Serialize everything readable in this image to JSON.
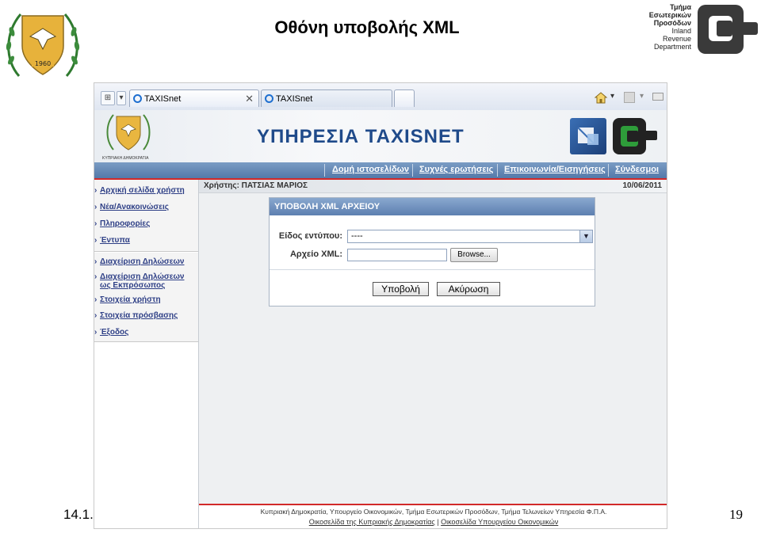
{
  "slide": {
    "title": "Οθόνη υποβολής XML",
    "date": "14.1.",
    "page_number": "19",
    "ird_lines": [
      "Τμήμα",
      "Εσωτερικών",
      "Προσόδων",
      "Inland",
      "Revenue",
      "Department"
    ],
    "emblem_year": "1960"
  },
  "browser": {
    "tabs": [
      {
        "label": "TAXISnet",
        "active": true
      },
      {
        "label": "TAXISnet",
        "active": false
      }
    ],
    "close_glyph": "✕"
  },
  "site": {
    "title": "ΥΠΗΡΕΣΙΑ TAXISNET",
    "emblem_caption": "ΚΥΠΡΙΑΚΗ ΔΗΜΟΚΡΑΤΙΑ",
    "nav": [
      "Δομή ιστοσελίδων",
      "Συχνές ερωτήσεις",
      "Επικοινωνία/Εισηγήσεις",
      "Σύνδεσμοι"
    ],
    "user_label": "Χρήστης: ΠΑΤΣΙΑΣ ΜΑΡΙΟΣ",
    "date": "10/06/2011"
  },
  "menu": {
    "group1": [
      "Αρχική σελίδα χρήστη",
      "Νέα/Ανακοινώσεις",
      "Πληροφορίες",
      "Έντυπα"
    ],
    "group2": [
      "Διαχείριση Δηλώσεων",
      "Διαχείριση Δηλώσεων ως Εκπρόσωπος",
      "Στοιχεία χρήστη",
      "Στοιχεία πρόσβασης",
      "Έξοδος"
    ]
  },
  "form": {
    "header": "ΥΠΟΒΟΛΗ XML ΑΡΧΕΙΟΥ",
    "type_label": "Είδος εντύπου:",
    "type_value": "----",
    "file_label": "Αρχείο XML:",
    "file_value": "",
    "browse_label": "Browse...",
    "submit_label": "Υποβολή",
    "cancel_label": "Ακύρωση"
  },
  "footer": {
    "line1": "Κυπριακή Δημοκρατία, Υπουργείο Οικονομικών, Τμήμα Εσωτερικών Προσόδων, Τμήμα Τελωνείων Υπηρεσία Φ.Π.Α.",
    "link1": "Οικοσελίδα της Κυπριακής Δημοκρατίας",
    "separator": "|",
    "link2": "Οικοσελίδα Υπουργείου Οικονομικών"
  },
  "colors": {
    "nav_bar": "#5d80ae",
    "accent_red": "#d22929",
    "title_blue": "#1f4a8a",
    "menu_link": "#2e3f86",
    "ird_logo": "#3a3a3a"
  }
}
